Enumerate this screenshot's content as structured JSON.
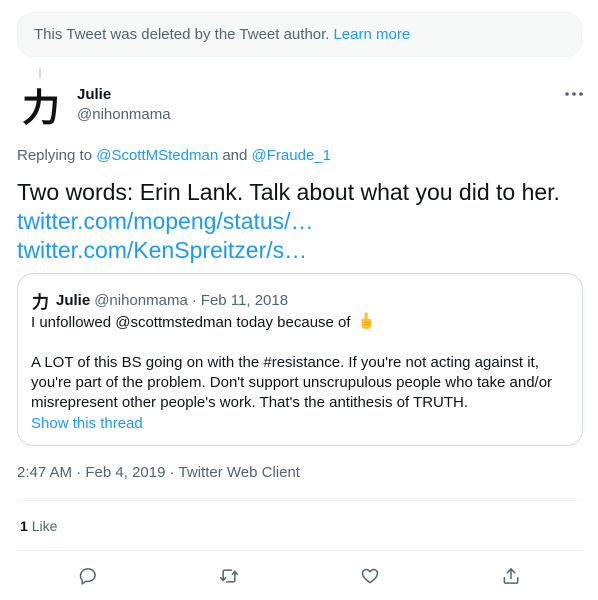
{
  "deleted_notice": {
    "text": "This Tweet was deleted by the Tweet author.",
    "link": "Learn more"
  },
  "author": {
    "avatar_glyph": "力",
    "name": "Julie",
    "handle": "@nihonmama"
  },
  "reply": {
    "prefix": "Replying to",
    "mention1": "@ScottMStedman",
    "conjunction": "and",
    "mention2": "@Fraude_1"
  },
  "tweet": {
    "text": "Two words: Erin Lank. Talk about what you did to her.",
    "link1": "twitter.com/mopeng/status/…",
    "link2": "twitter.com/KenSpreitzer/s…"
  },
  "quoted_tweet": {
    "avatar_glyph": "力",
    "name": "Julie",
    "handle": "@nihonmama",
    "separator": "·",
    "date": "Feb 11, 2018",
    "line1": "I unfollowed @scottmstedman today because of",
    "emoji_icon": "backhand-index-pointing-up-icon",
    "paragraph2": "A LOT of this BS going on with the #resistance. If you're not acting against it, you're part of the problem. Don't support unscrupulous people who take and/or misrepresent other people's work. That's the antithesis of TRUTH.",
    "show_thread": "Show this thread"
  },
  "meta": {
    "time": "2:47 AM",
    "separator": "·",
    "date": "Feb 4, 2019",
    "source": "Twitter Web Client"
  },
  "stats": {
    "likes_count": "1",
    "likes_label": "Like"
  },
  "actions": {
    "reply_icon": "reply-icon",
    "retweet_icon": "retweet-icon",
    "like_icon": "heart-icon",
    "share_icon": "share-icon"
  },
  "colors": {
    "link": "#1d9bf0",
    "secondary_text": "#536471",
    "primary_text": "#0f1419",
    "border": "#cfd9de"
  }
}
